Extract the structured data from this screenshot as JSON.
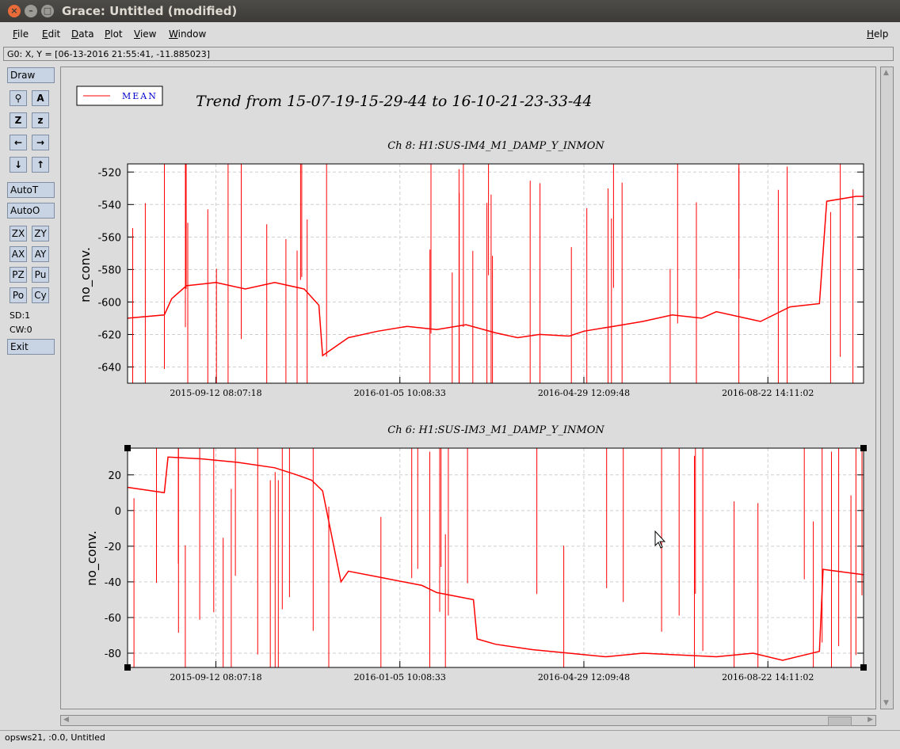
{
  "window": {
    "title": "Grace: Untitled (modified)"
  },
  "menu": [
    {
      "label": "File"
    },
    {
      "label": "Edit"
    },
    {
      "label": "Data"
    },
    {
      "label": "Plot"
    },
    {
      "label": "View"
    },
    {
      "label": "Window"
    }
  ],
  "help_label": "Help",
  "location": "G0: X, Y = [06-13-2016 21:55:41, -11.885023]",
  "toolbar": {
    "draw": "Draw",
    "autot": "AutoT",
    "autoo": "AutoO",
    "zx": "ZX",
    "zy": "ZY",
    "ax": "AX",
    "ay": "AY",
    "pz": "PZ",
    "pu": "Pu",
    "po": "Po",
    "cy": "Cy",
    "sd": "SD:1",
    "cw": "CW:0",
    "exit": "Exit",
    "z_upper": "Z",
    "z_lower": "z",
    "zoom_glyph": "⚲",
    "axes_glyph": "A",
    "left_glyph": "←",
    "right_glyph": "→",
    "down_glyph": "↓",
    "up_glyph": "↑"
  },
  "status": "opsws21, :0.0, Untitled",
  "colors": {
    "series": "#ff0000",
    "legend_text": "#0000cc"
  },
  "plot": {
    "title": "Trend from 15-07-19-15-29-44 to 16-10-21-23-33-44",
    "legend": "MEAN"
  },
  "chart_data": [
    {
      "type": "line",
      "title": "Ch 8: H1:SUS-IM4_M1_DAMP_Y_INMON",
      "ylabel": "no_conv.",
      "ylim": [
        -650,
        -515
      ],
      "yticks": [
        -520,
        -540,
        -560,
        -580,
        -600,
        -620,
        -640
      ],
      "xtick_labels": [
        "2015-09-12 08:07:18",
        "2016-01-05 10:08:33",
        "2016-04-29 12:09:48",
        "2016-08-22 14:11:02"
      ],
      "series": [
        {
          "name": "MEAN",
          "x": [
            0.0,
            0.05,
            0.06,
            0.08,
            0.12,
            0.16,
            0.2,
            0.24,
            0.26,
            0.265,
            0.3,
            0.34,
            0.38,
            0.42,
            0.46,
            0.5,
            0.53,
            0.56,
            0.6,
            0.62,
            0.66,
            0.7,
            0.74,
            0.78,
            0.8,
            0.84,
            0.86,
            0.9,
            0.94,
            0.95,
            0.99,
            1.0
          ],
          "y": [
            -610,
            -608,
            -598,
            -590,
            -588,
            -592,
            -588,
            -592,
            -602,
            -633,
            -622,
            -618,
            -615,
            -617,
            -614,
            -619,
            -622,
            -620,
            -621,
            -618,
            -615,
            -612,
            -608,
            -610,
            -606,
            -610,
            -612,
            -603,
            -601,
            -538,
            -535,
            -535
          ]
        }
      ]
    },
    {
      "type": "line",
      "title": "Ch 6: H1:SUS-IM3_M1_DAMP_Y_INMON",
      "ylabel": "no_conv.",
      "ylim": [
        -88,
        35
      ],
      "yticks": [
        20,
        0,
        -20,
        -40,
        -60,
        -80
      ],
      "xtick_labels": [
        "2015-09-12 08:07:18",
        "2016-01-05 10:08:33",
        "2016-04-29 12:09:48",
        "2016-08-22 14:11:02"
      ],
      "series": [
        {
          "name": "MEAN",
          "x": [
            0.0,
            0.05,
            0.055,
            0.1,
            0.15,
            0.2,
            0.23,
            0.25,
            0.265,
            0.29,
            0.3,
            0.35,
            0.4,
            0.42,
            0.47,
            0.475,
            0.5,
            0.55,
            0.6,
            0.65,
            0.7,
            0.75,
            0.8,
            0.85,
            0.89,
            0.94,
            0.945,
            1.0
          ],
          "y": [
            13,
            10,
            30,
            29,
            27,
            24,
            20,
            17,
            11,
            -40,
            -34,
            -38,
            -42,
            -46,
            -50,
            -72,
            -75,
            -78,
            -80,
            -82,
            -80,
            -81,
            -82,
            -80,
            -84,
            -79,
            -33,
            -36
          ]
        }
      ]
    }
  ]
}
